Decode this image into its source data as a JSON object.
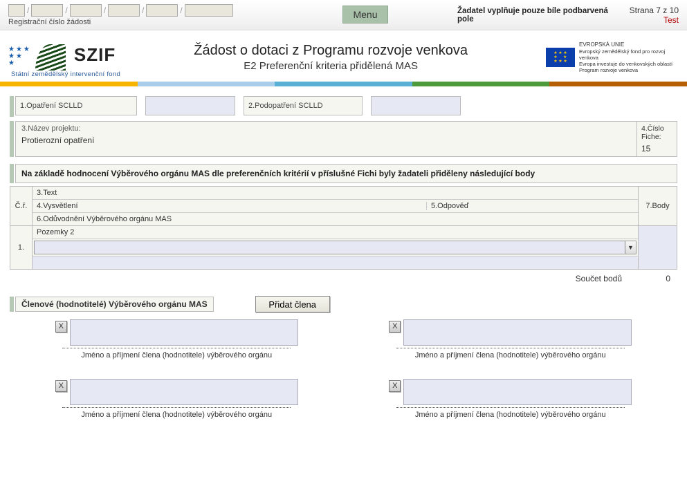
{
  "top": {
    "reg_label": "Registrační číslo žádosti",
    "menu_label": "Menu",
    "note": "Žadatel vyplňuje pouze bíle podbarvená pole",
    "page_indicator": "Strana 7 z 10",
    "test_label": "Test"
  },
  "header": {
    "logo_text": "SZIF",
    "logo_under": "Státní zemědělský intervenční fond",
    "title1": "Žádost o dotaci z Programu rozvoje venkova",
    "title2": "E2 Preferenční kriteria přidělená MAS",
    "eu_l1": "EVROPSKÁ UNIE",
    "eu_l2": "Evropský zemědělský fond pro rozvoj venkova",
    "eu_l3": "Evropa investuje do venkovských oblastí",
    "eu_l4": "Program rozvoje venkova"
  },
  "fields": {
    "opatreni_label": "1.Opatření SCLLD",
    "opatreni_value": "",
    "podopatreni_label": "2.Podopatření SCLLD",
    "podopatreni_value": "",
    "projekt_label": "3.Název projektu:",
    "projekt_value": "Protierozní opatření",
    "fiche_label": "4.Číslo Fiche:",
    "fiche_value": "15"
  },
  "criteria": {
    "section_title": "Na základě hodnocení Výběrového orgánu MAS dle preferenčních kritérií v příslušné Fichi byly žadateli přiděleny následující body",
    "col_cr": "Č.ř.",
    "col_text": "3.Text",
    "col_vysv": "4.Vysvětlení",
    "col_odp": "5.Odpověď",
    "col_oduv": "6.Odůvodnění Výběrového orgánu MAS",
    "col_body": "7.Body",
    "rows": [
      {
        "num": "1.",
        "text": "Pozemky 2",
        "vysv": "",
        "odp": "",
        "oduv": "",
        "body": ""
      }
    ],
    "sum_label": "Součet bodů",
    "sum_value": "0"
  },
  "members": {
    "title": "Členové (hodnotitelé) Výběrového orgánu MAS",
    "add_label": "Přidat člena",
    "caption": "Jméno a příjmení člena (hodnotitele) výběrového orgánu",
    "remove_label": "X",
    "list": [
      {
        "name": ""
      },
      {
        "name": ""
      },
      {
        "name": ""
      },
      {
        "name": ""
      }
    ]
  }
}
